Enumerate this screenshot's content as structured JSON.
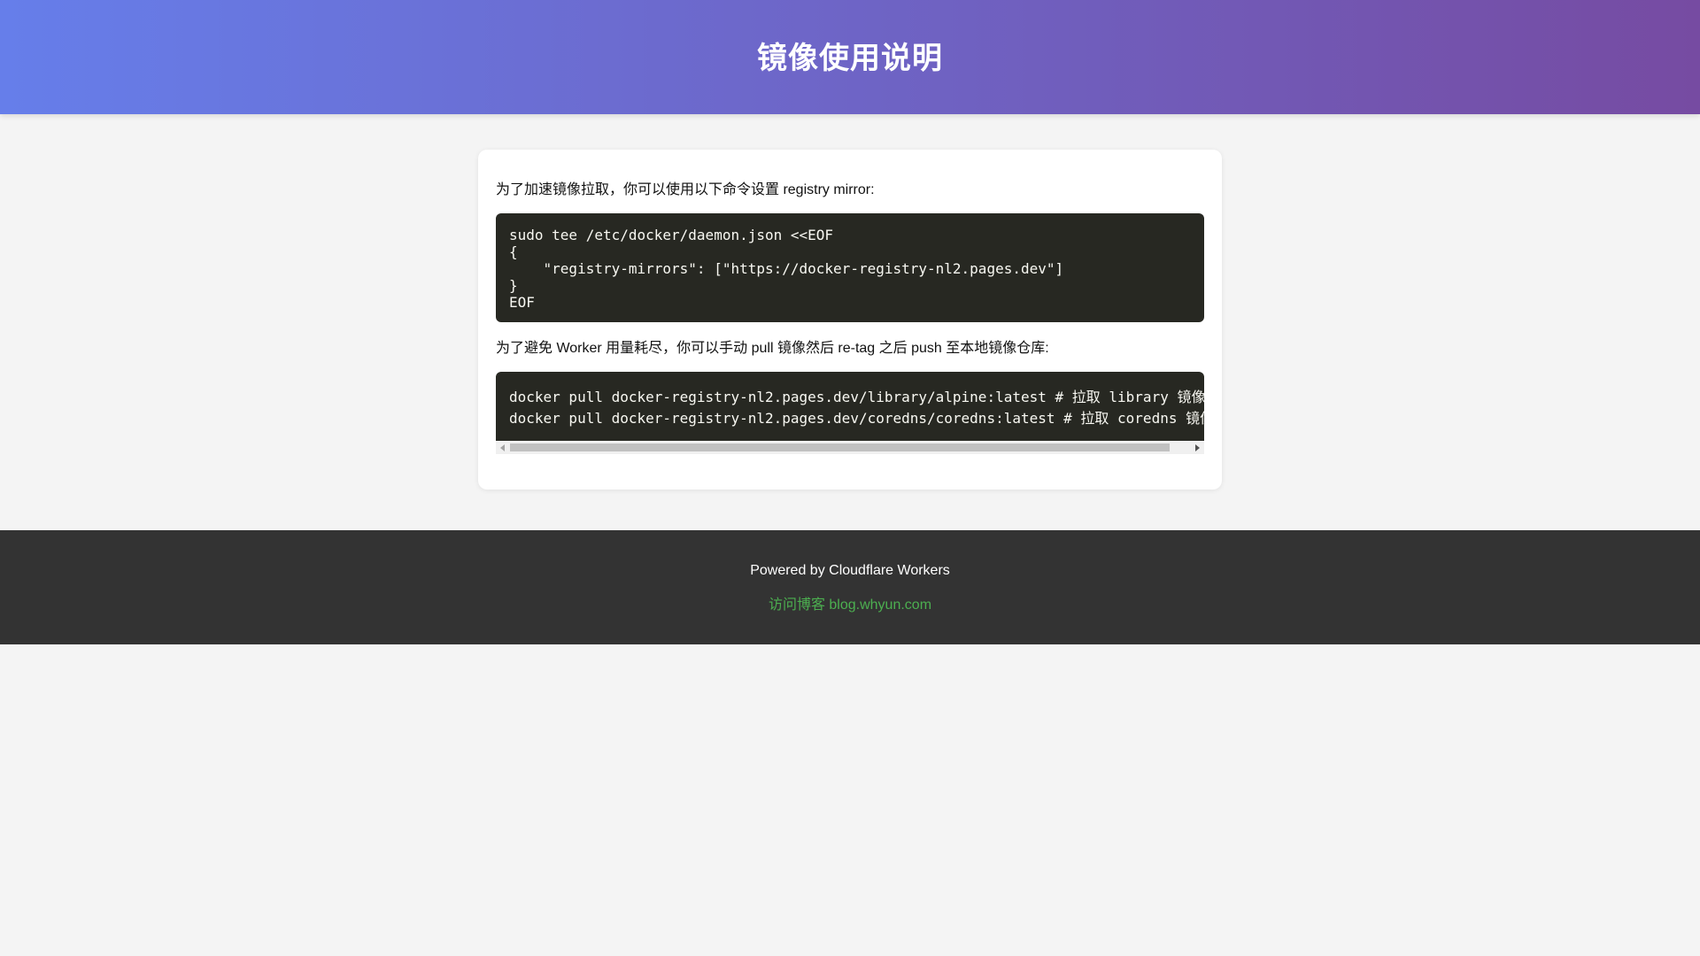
{
  "header": {
    "title": "镜像使用说明"
  },
  "main": {
    "intro_text": "为了加速镜像拉取，你可以使用以下命令设置 registry mirror:",
    "code_block_1": "sudo tee /etc/docker/daemon.json <<EOF\n{\n    \"registry-mirrors\": [\"https://docker-registry-nl2.pages.dev\"]\n}\nEOF",
    "worker_text": "为了避免 Worker 用量耗尽，你可以手动 pull 镜像然后 re-tag 之后 push 至本地镜像仓库:",
    "code_block_2": "docker pull docker-registry-nl2.pages.dev/library/alpine:latest # 拉取 library 镜像\ndocker pull docker-registry-nl2.pages.dev/coredns/coredns:latest # 拉取 coredns 镜像"
  },
  "footer": {
    "powered_text": "Powered by Cloudflare Workers",
    "blog_link_text": "访问博客 blog.whyun.com"
  },
  "colors": {
    "header_gradient_start": "#667eea",
    "header_gradient_end": "#764ba2",
    "code_background": "#272822",
    "footer_background": "#333333",
    "link_green": "#4caf50"
  }
}
